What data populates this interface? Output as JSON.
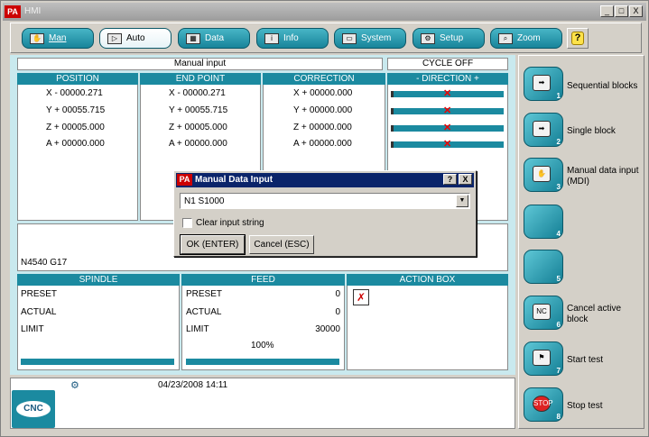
{
  "window": {
    "title": "HMI",
    "logo": "PA",
    "controls": [
      "_",
      "□",
      "X"
    ]
  },
  "toolbar": {
    "buttons": [
      {
        "label": "Man",
        "icon": "hand-icon"
      },
      {
        "label": "Auto",
        "icon": "auto-icon"
      },
      {
        "label": "Data",
        "icon": "data-icon"
      },
      {
        "label": "Info",
        "icon": "info-icon"
      },
      {
        "label": "System",
        "icon": "system-icon"
      },
      {
        "label": "Setup",
        "icon": "setup-icon"
      },
      {
        "label": "Zoom",
        "icon": "zoom-icon"
      }
    ],
    "help_icon": "?"
  },
  "header": {
    "mode": "Manual input",
    "cycle_status": "CYCLE OFF"
  },
  "position": {
    "title": "POSITION",
    "rows": [
      "X - 00000.271",
      "Y + 00055.715",
      "Z + 00005.000",
      "A + 00000.000"
    ]
  },
  "end_point": {
    "title": "END POINT",
    "rows": [
      "X - 00000.271",
      "Y + 00055.715",
      "Z + 00005.000",
      "A + 00000.000"
    ]
  },
  "correction": {
    "title": "CORRECTION",
    "rows": [
      "X + 00000.000",
      "Y + 00000.000",
      "Z + 00000.000",
      "A + 00000.000"
    ]
  },
  "direction": {
    "title": "- DIRECTION +",
    "marker": "✕"
  },
  "block_text": "N4540 G17",
  "spindle": {
    "title": "SPINDLE",
    "preset": "PRESET",
    "actual": "ACTUAL",
    "limit": "LIMIT"
  },
  "feed": {
    "title": "FEED",
    "preset_label": "PRESET",
    "preset_value": "0",
    "actual_label": "ACTUAL",
    "actual_value": "0",
    "limit_label": "LIMIT",
    "limit_value": "30000",
    "override": "100%"
  },
  "action_box": {
    "title": "ACTION BOX"
  },
  "status": {
    "datetime": "04/23/2008 14:11",
    "logo": "CNC"
  },
  "side": [
    {
      "num": "1",
      "label": "Sequential blocks",
      "icon": "sequential-icon"
    },
    {
      "num": "2",
      "label": "Single block",
      "icon": "single-block-icon"
    },
    {
      "num": "3",
      "label": "Manual data input (MDI)",
      "icon": "mdi-icon"
    },
    {
      "num": "4",
      "label": "",
      "icon": ""
    },
    {
      "num": "5",
      "label": "",
      "icon": ""
    },
    {
      "num": "6",
      "label": "Cancel active block",
      "icon": "cancel-block-icon"
    },
    {
      "num": "7",
      "label": "Start test",
      "icon": "checkered-flag-icon"
    },
    {
      "num": "8",
      "label": "Stop test",
      "icon": "stop-icon"
    }
  ],
  "dialog": {
    "logo": "PA",
    "title": "Manual Data Input",
    "input_value": "N1 S1000",
    "checkbox_label": "Clear input string",
    "ok_label": "OK (ENTER)",
    "cancel_label": "Cancel (ESC)",
    "title_buttons": [
      "?",
      "X"
    ]
  }
}
